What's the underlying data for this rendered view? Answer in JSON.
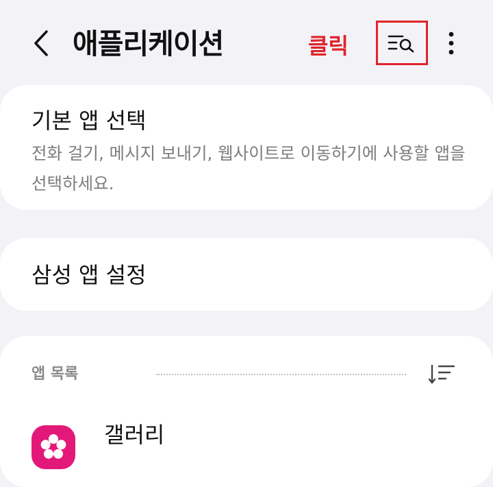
{
  "header": {
    "title": "애플리케이션",
    "annotation": "클릭",
    "back_icon": "back-arrow-icon",
    "search_icon": "filter-search-icon",
    "more_icon": "more-vertical-icon"
  },
  "default_apps": {
    "title": "기본 앱 선택",
    "description": "전화 걸기, 메시지 보내기, 웹사이트로 이동하기에 사용할 앱을 선택하세요."
  },
  "samsung_settings": {
    "title": "삼성 앱 설정"
  },
  "app_list": {
    "label": "앱 목록",
    "sort_icon": "sort-icon",
    "items": [
      {
        "name": "갤러리",
        "icon": "gallery-flower-icon"
      }
    ]
  },
  "colors": {
    "annotation_red": "#e0232b",
    "gallery_pink": "#e3197a",
    "background": "#f3f2f7",
    "card": "#ffffff",
    "secondary_text": "#7c7c7c"
  }
}
